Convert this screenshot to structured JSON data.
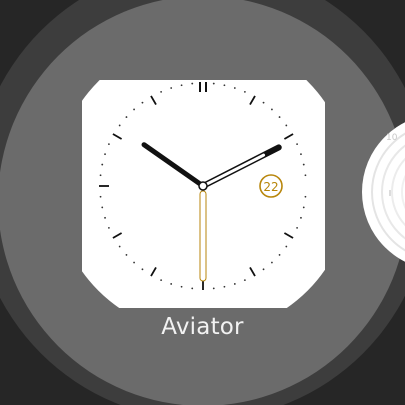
{
  "carousel": {
    "selected_face": {
      "name": "Aviator",
      "preview": {
        "time": {
          "hour": 10,
          "minute": 10,
          "second": 30
        },
        "date_complication": "22",
        "accent_color": "#b8860b",
        "background_color": "#ffffff",
        "hand_color": "#111111"
      }
    },
    "next_face_peek": {
      "visible": true,
      "label": "10"
    }
  },
  "colors": {
    "screen_background": "#262626",
    "outer_ring": "#3d3d3d",
    "card_background": "#6b6b6b",
    "label_text": "#f2f2f2"
  }
}
